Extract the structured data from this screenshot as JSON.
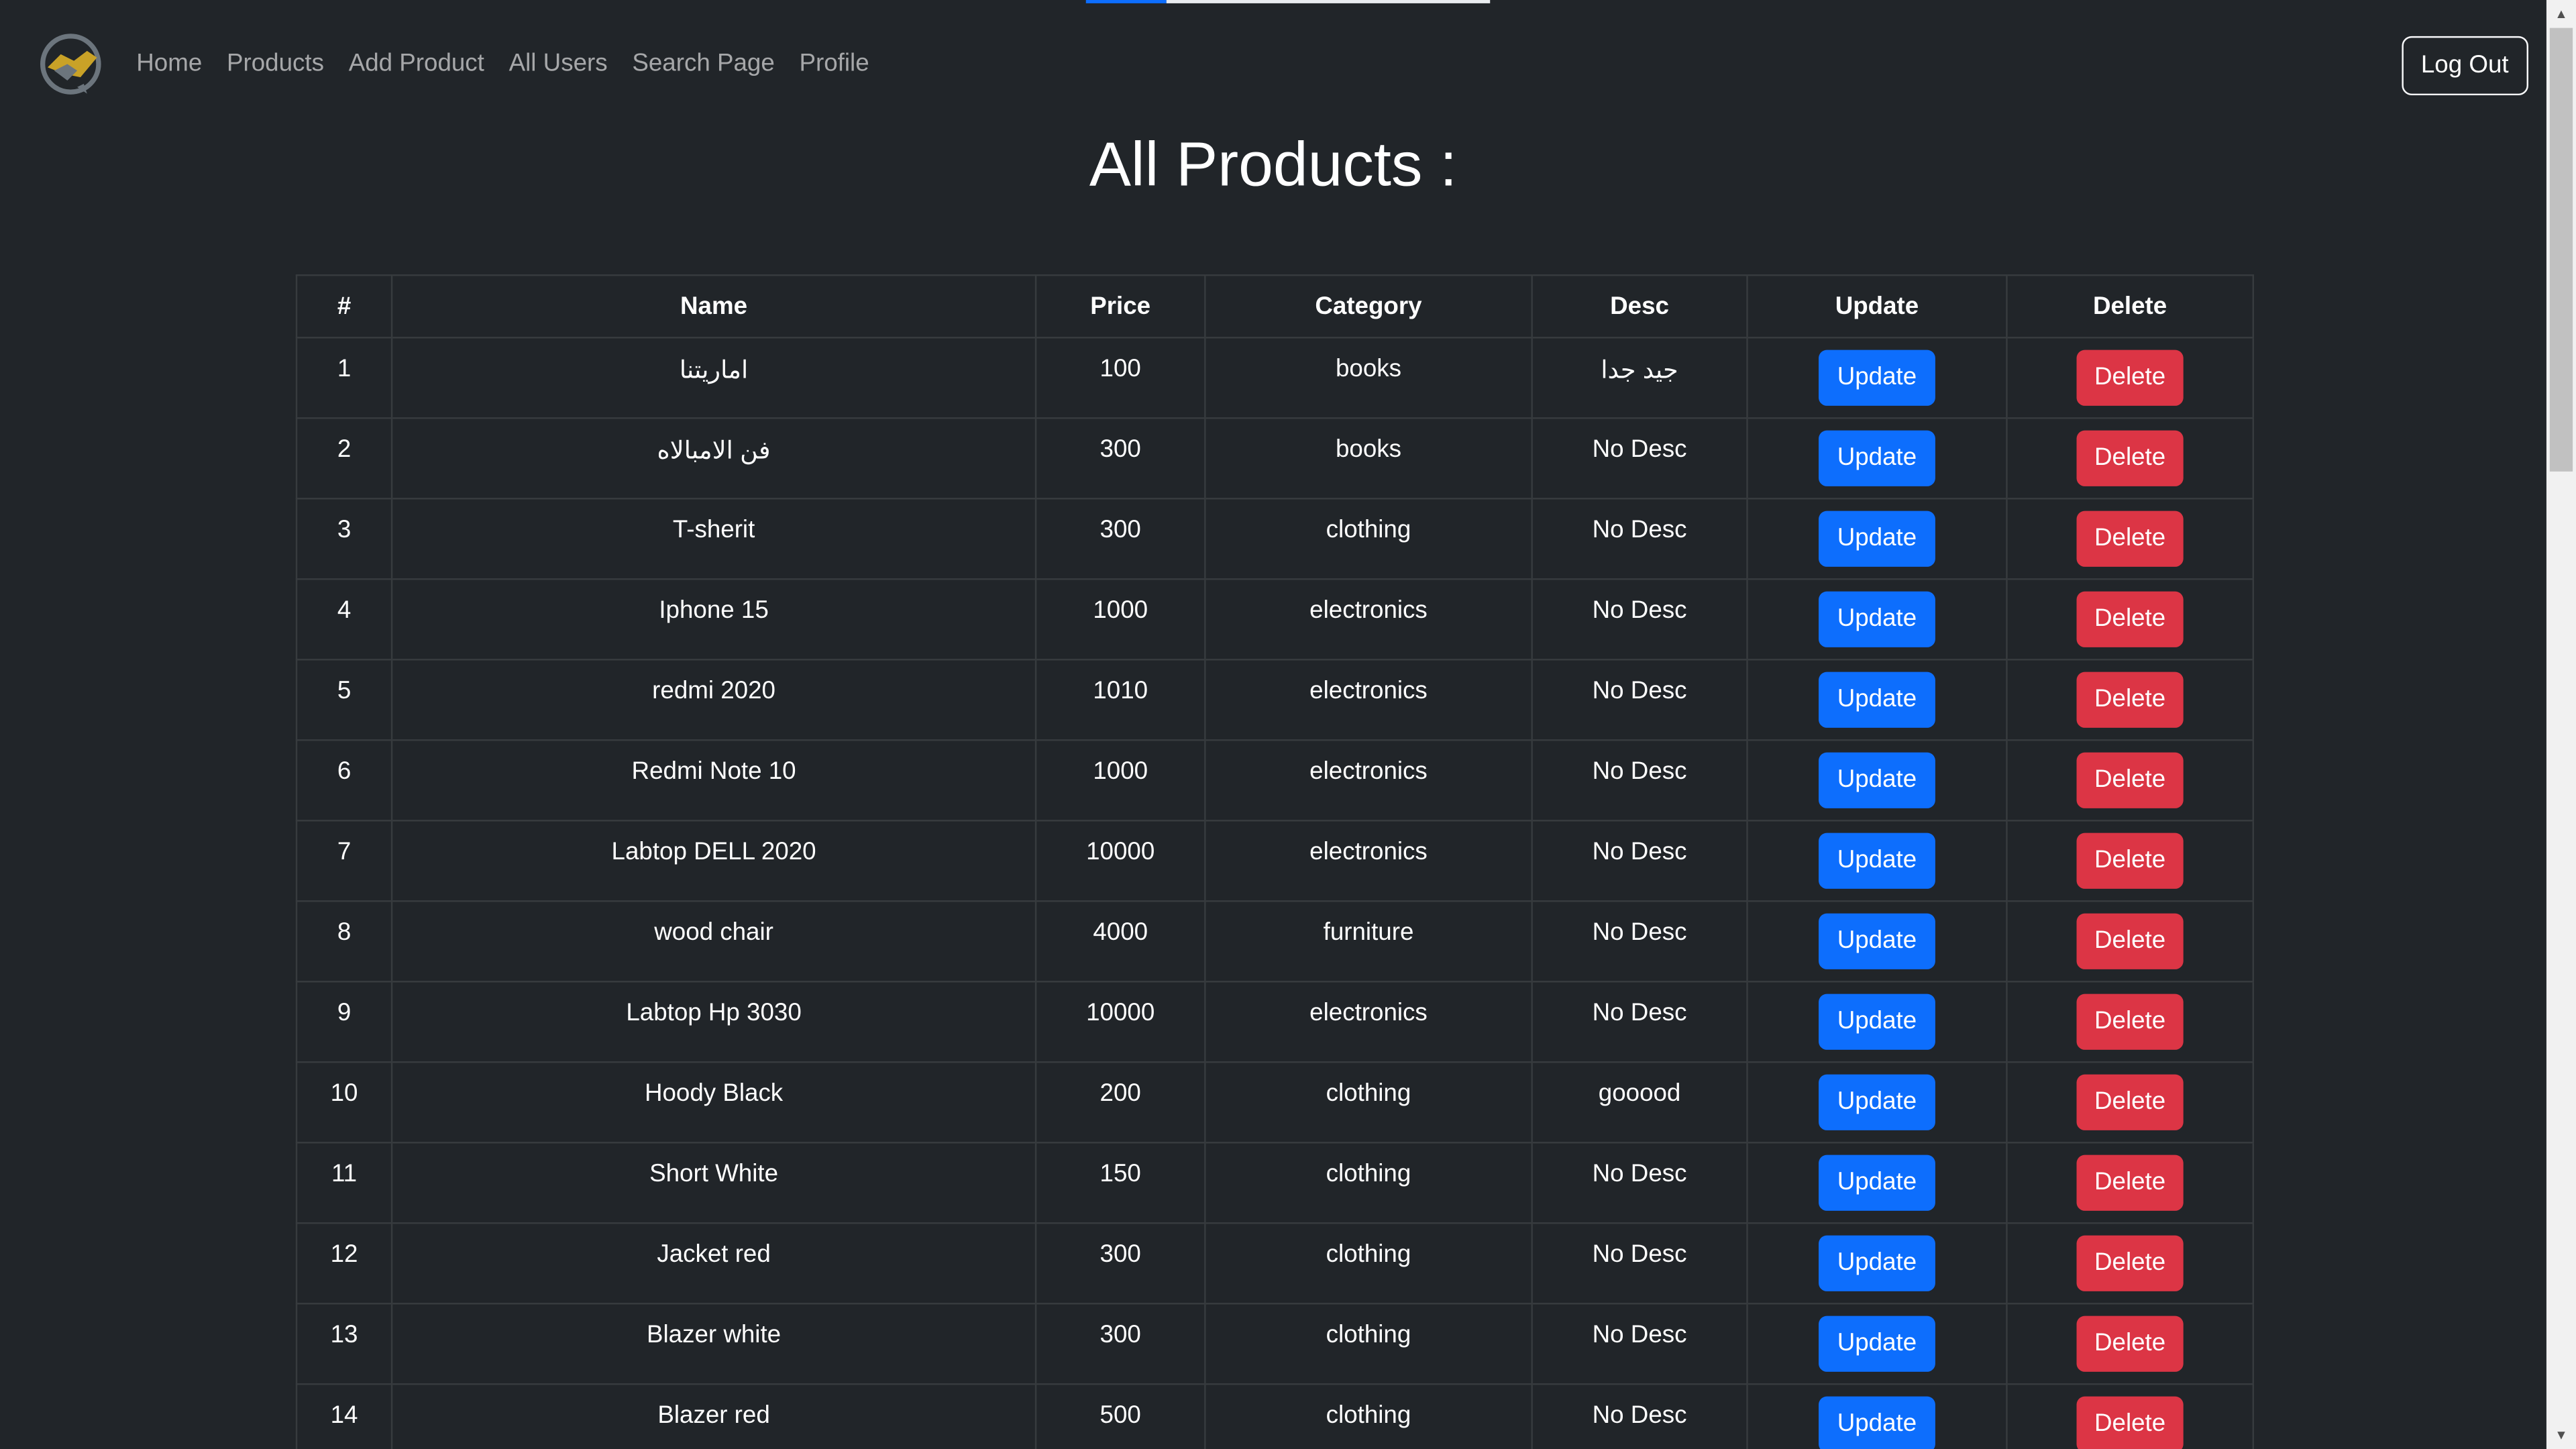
{
  "nav": {
    "links": [
      "Home",
      "Products",
      "Add Product",
      "All Users",
      "Search Page",
      "Profile"
    ],
    "logout_label": "Log Out"
  },
  "page": {
    "title": "All Products :"
  },
  "table": {
    "headers": [
      "#",
      "Name",
      "Price",
      "Category",
      "Desc",
      "Update",
      "Delete"
    ],
    "update_label": "Update",
    "delete_label": "Delete",
    "rows": [
      {
        "num": "1",
        "name": "اماريتنا",
        "price": "100",
        "category": "books",
        "desc": "جيد جدا"
      },
      {
        "num": "2",
        "name": "فن الامبالاه",
        "price": "300",
        "category": "books",
        "desc": "No Desc"
      },
      {
        "num": "3",
        "name": "T-sherit",
        "price": "300",
        "category": "clothing",
        "desc": "No Desc"
      },
      {
        "num": "4",
        "name": "Iphone 15",
        "price": "1000",
        "category": "electronics",
        "desc": "No Desc"
      },
      {
        "num": "5",
        "name": "redmi 2020",
        "price": "1010",
        "category": "electronics",
        "desc": "No Desc"
      },
      {
        "num": "6",
        "name": "Redmi Note 10",
        "price": "1000",
        "category": "electronics",
        "desc": "No Desc"
      },
      {
        "num": "7",
        "name": "Labtop DELL 2020",
        "price": "10000",
        "category": "electronics",
        "desc": "No Desc"
      },
      {
        "num": "8",
        "name": "wood chair",
        "price": "4000",
        "category": "furniture",
        "desc": "No Desc"
      },
      {
        "num": "9",
        "name": "Labtop Hp 3030",
        "price": "10000",
        "category": "electronics",
        "desc": "No Desc"
      },
      {
        "num": "10",
        "name": "Hoody Black",
        "price": "200",
        "category": "clothing",
        "desc": "gooood"
      },
      {
        "num": "11",
        "name": "Short White",
        "price": "150",
        "category": "clothing",
        "desc": "No Desc"
      },
      {
        "num": "12",
        "name": "Jacket red",
        "price": "300",
        "category": "clothing",
        "desc": "No Desc"
      },
      {
        "num": "13",
        "name": "Blazer white",
        "price": "300",
        "category": "clothing",
        "desc": "No Desc"
      },
      {
        "num": "14",
        "name": "Blazer red",
        "price": "500",
        "category": "clothing",
        "desc": "No Desc"
      }
    ]
  },
  "colors": {
    "background": "#212529",
    "update_button": "#0d6efd",
    "delete_button": "#dc3545",
    "logo_gold": "#c9a227",
    "logo_gray": "#6c757d"
  },
  "icons": {
    "logo": "handshake-logo-icon"
  }
}
